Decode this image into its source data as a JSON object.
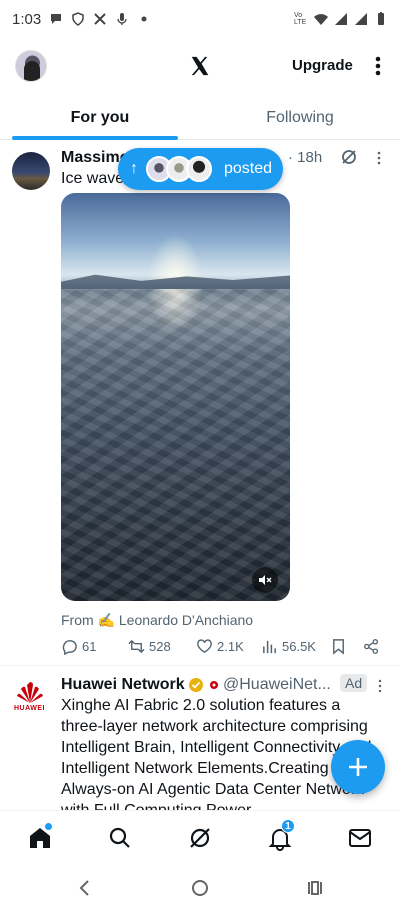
{
  "status_bar": {
    "time": "1:03",
    "left_icons": [
      "chat-bubble-icon",
      "vpn-shield-icon",
      "x-notification-icon",
      "mic-icon",
      "dot-icon"
    ],
    "network_label": "Vo LTE",
    "right_icons": [
      "wifi-icon",
      "signal-icon",
      "signal-icon",
      "battery-icon"
    ]
  },
  "header": {
    "logo": "x-logo-icon",
    "upgrade_label": "Upgrade"
  },
  "tabs": [
    {
      "label": "For you",
      "active": true
    },
    {
      "label": "Following",
      "active": false
    }
  ],
  "new_posts_pill": {
    "label": "posted",
    "icon": "arrow-up-icon"
  },
  "tweets": [
    {
      "author": "Massimo",
      "time": "18h",
      "text": "Ice wave",
      "media": {
        "type": "video",
        "muted": true,
        "description_icon": "mute-icon"
      },
      "from_label": "From ✍️ Leonardo D'Anchiano",
      "actions": {
        "replies": "61",
        "reposts": "528",
        "likes": "2.1K",
        "views": "56.5K"
      }
    },
    {
      "author": "Huawei Network",
      "logo_word": "HUAWEI",
      "handle": "@HuaweiNet...",
      "ad_label": "Ad",
      "text": "Xinghe AI Fabric 2.0 solution features a three-layer network architecture comprising Intelligent Brain, Intelligent Connectivity and Intelligent Network Elements.Creating an Always-on AI Agentic Data Center Network with Full Computing Power"
    }
  ],
  "bottom_nav": {
    "items": [
      "home-icon",
      "search-icon",
      "grok-icon",
      "notifications-icon",
      "messages-icon"
    ],
    "notification_count": "1"
  },
  "colors": {
    "accent": "#1d9bf0",
    "text": "#0f1419",
    "secondary": "#536471",
    "huawei_red": "#c7000b"
  }
}
